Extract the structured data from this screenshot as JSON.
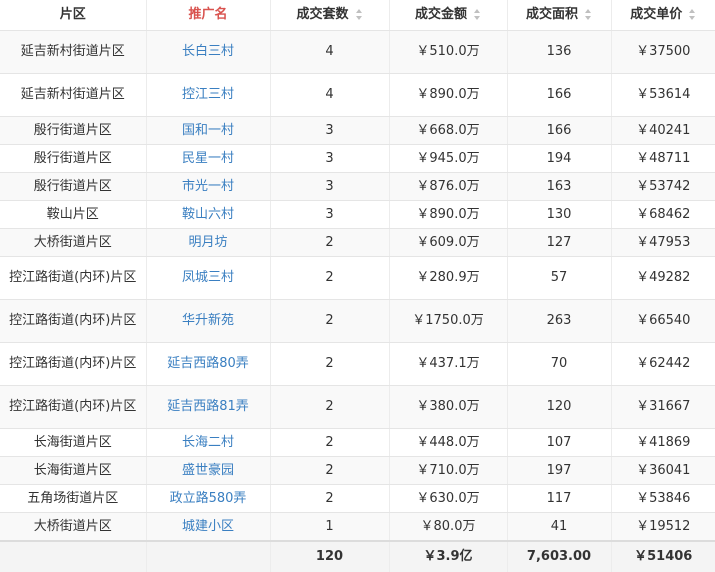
{
  "headers": [
    "片区",
    "推广名",
    "成交套数",
    "成交金额",
    "成交面积",
    "成交单价"
  ],
  "rows": [
    {
      "area": "延吉新村街道片区",
      "name": "长白三村",
      "count": "4",
      "amount": "￥510.0万",
      "size": "136",
      "price": "￥37500",
      "tall": true
    },
    {
      "area": "延吉新村街道片区",
      "name": "控江三村",
      "count": "4",
      "amount": "￥890.0万",
      "size": "166",
      "price": "￥53614",
      "tall": true
    },
    {
      "area": "殷行街道片区",
      "name": "国和一村",
      "count": "3",
      "amount": "￥668.0万",
      "size": "166",
      "price": "￥40241",
      "tall": false
    },
    {
      "area": "殷行街道片区",
      "name": "民星一村",
      "count": "3",
      "amount": "￥945.0万",
      "size": "194",
      "price": "￥48711",
      "tall": false
    },
    {
      "area": "殷行街道片区",
      "name": "市光一村",
      "count": "3",
      "amount": "￥876.0万",
      "size": "163",
      "price": "￥53742",
      "tall": false
    },
    {
      "area": "鞍山片区",
      "name": "鞍山六村",
      "count": "3",
      "amount": "￥890.0万",
      "size": "130",
      "price": "￥68462",
      "tall": false
    },
    {
      "area": "大桥街道片区",
      "name": "明月坊",
      "count": "2",
      "amount": "￥609.0万",
      "size": "127",
      "price": "￥47953",
      "tall": false
    },
    {
      "area": "控江路街道(内环)片区",
      "name": "凤城三村",
      "count": "2",
      "amount": "￥280.9万",
      "size": "57",
      "price": "￥49282",
      "tall": true
    },
    {
      "area": "控江路街道(内环)片区",
      "name": "华升新苑",
      "count": "2",
      "amount": "￥1750.0万",
      "size": "263",
      "price": "￥66540",
      "tall": true
    },
    {
      "area": "控江路街道(内环)片区",
      "name": "延吉西路80弄",
      "count": "2",
      "amount": "￥437.1万",
      "size": "70",
      "price": "￥62442",
      "tall": true
    },
    {
      "area": "控江路街道(内环)片区",
      "name": "延吉西路81弄",
      "count": "2",
      "amount": "￥380.0万",
      "size": "120",
      "price": "￥31667",
      "tall": true
    },
    {
      "area": "长海街道片区",
      "name": "长海二村",
      "count": "2",
      "amount": "￥448.0万",
      "size": "107",
      "price": "￥41869",
      "tall": false
    },
    {
      "area": "长海街道片区",
      "name": "盛世豪园",
      "count": "2",
      "amount": "￥710.0万",
      "size": "197",
      "price": "￥36041",
      "tall": false
    },
    {
      "area": "五角场街道片区",
      "name": "政立路580弄",
      "count": "2",
      "amount": "￥630.0万",
      "size": "117",
      "price": "￥53846",
      "tall": false
    },
    {
      "area": "大桥街道片区",
      "name": "城建小区",
      "count": "1",
      "amount": "￥80.0万",
      "size": "41",
      "price": "￥19512",
      "tall": false
    }
  ],
  "totals": {
    "count": "120",
    "amount": "￥3.9亿",
    "size": "7,603.00",
    "price": "￥51406"
  },
  "colors": {
    "active_header": "#d9534f",
    "link": "#3a7fc1"
  }
}
